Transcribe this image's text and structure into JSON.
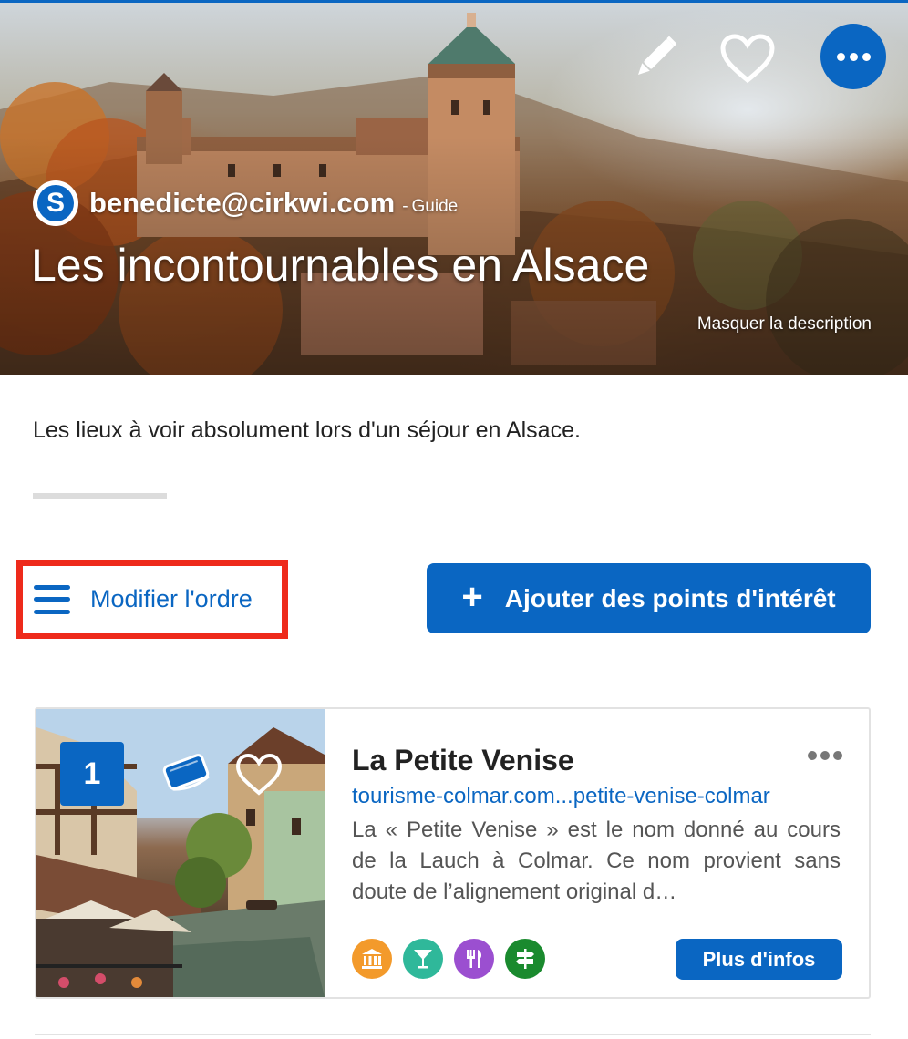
{
  "hero": {
    "author_name": "benedicte@cirkwi.com",
    "author_separator": "-",
    "author_role": "Guide",
    "author_logo_letter": "S",
    "title": "Les incontournables en Alsace",
    "hide_description": "Masquer la description",
    "actions": [
      "pencil-icon",
      "heart-icon",
      "more-icon"
    ]
  },
  "description": "Les lieux à voir absolument lors d'un séjour en Alsace.",
  "toolbar": {
    "reorder_label": "Modifier l'ordre",
    "add_poi_label": "Ajouter des points d'intérêt",
    "add_poi_icon": "+"
  },
  "poi_list": [
    {
      "rank": "1",
      "title": "La Petite Venise",
      "link": "tourisme-colmar.com...petite-venise-colmar",
      "description": "La « Petite Venise » est le nom donné au cours de la Lauch à Colmar. Ce nom provient sans doute de l’alignement original d…",
      "more_info_label": "Plus d'infos",
      "categories": [
        {
          "icon": "museum-icon",
          "color": "#f39a2b"
        },
        {
          "icon": "cocktail-icon",
          "color": "#2fb89a"
        },
        {
          "icon": "restaurant-icon",
          "color": "#9b4fd0"
        },
        {
          "icon": "signpost-icon",
          "color": "#1a8a2e"
        }
      ]
    }
  ],
  "colors": {
    "accent": "#0a66c2",
    "highlight_border": "#ee2a1b"
  }
}
